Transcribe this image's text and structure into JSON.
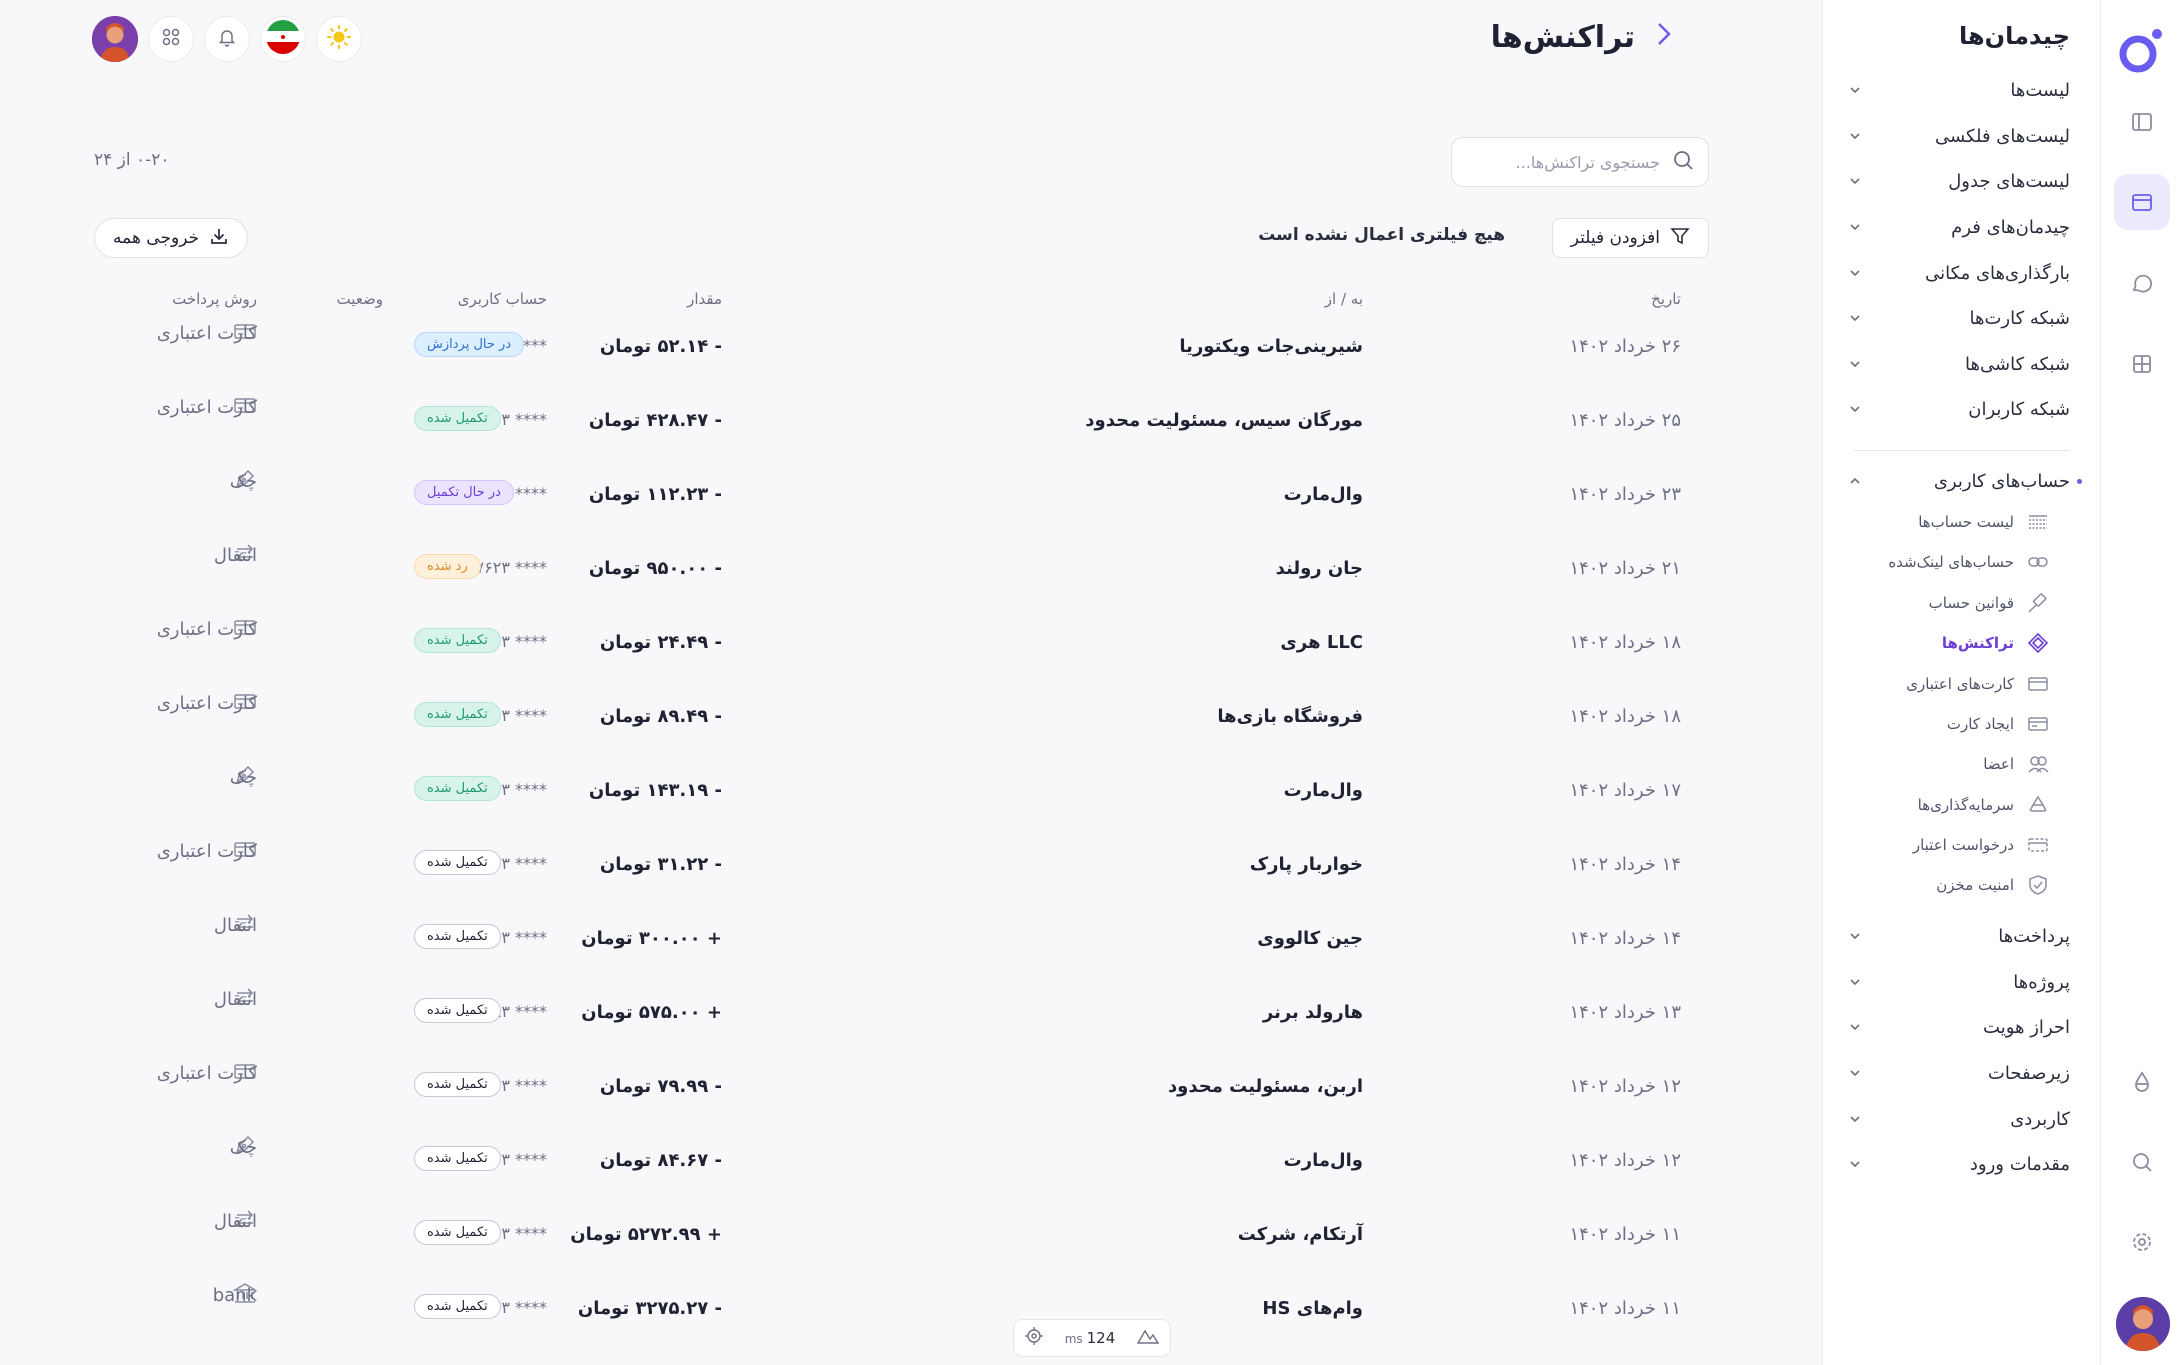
{
  "sidebar": {
    "title": "چیدمان‌ها",
    "items": [
      {
        "label": "لیست‌ها"
      },
      {
        "label": "لیست‌های فلکسی"
      },
      {
        "label": "لیست‌های جدول"
      },
      {
        "label": "چیدمان‌های فرم"
      },
      {
        "label": "بارگذاری‌های مکانی"
      },
      {
        "label": "شبکه کارت‌ها"
      },
      {
        "label": "شبکه کاشی‌ها"
      },
      {
        "label": "شبکه کاربران"
      }
    ],
    "section_label": "حساب‌های کاربری",
    "subitems": [
      {
        "label": "لیست حساب‌ها",
        "icon": "list-icon"
      },
      {
        "label": "حساب‌های لینک‌شده",
        "icon": "link-icon"
      },
      {
        "label": "قوانین حساب",
        "icon": "gavel-icon"
      },
      {
        "label": "تراکنش‌ها",
        "icon": "transactions-icon",
        "active": true
      },
      {
        "label": "کارت‌های اعتباری",
        "icon": "credit-card-icon"
      },
      {
        "label": "ایجاد کارت",
        "icon": "card-add-icon"
      },
      {
        "label": "اعضا",
        "icon": "members-icon"
      },
      {
        "label": "سرمایه‌گذاری‌ها",
        "icon": "recycle-icon"
      },
      {
        "label": "درخواست اعتبار",
        "icon": "credit-request-icon"
      },
      {
        "label": "امنیت مخزن",
        "icon": "shield-icon"
      }
    ],
    "bottom_items": [
      {
        "label": "پرداخت‌ها"
      },
      {
        "label": "پروژه‌ها"
      },
      {
        "label": "احراز هویت"
      },
      {
        "label": "زیرصفحات"
      },
      {
        "label": "کاربردی"
      },
      {
        "label": "مقدمات ورود"
      }
    ]
  },
  "page": {
    "title": "تراکنش‌ها",
    "count": "۰-۲۰ از ۲۴",
    "search_placeholder": "جستجوی تراکنش‌ها...",
    "filter_button": "افزودن فیلتر",
    "filter_status": "هیچ فیلتری اعمال نشده است",
    "export_button": "خروجی همه"
  },
  "table": {
    "headers": {
      "date": "تاریخ",
      "party": "به / از",
      "amount": "مقدار",
      "account": "حساب کاربری",
      "status": "وضعیت",
      "method": "روش پرداخت"
    },
    "rows": [
      {
        "date": "۲۶ خرداد ۱۴۰۲",
        "party": "شیرینی‌جات ویکتوریا",
        "amount": "- ۵۲.۱۴ تومان",
        "account": "**** ۷۶۲۳",
        "status": "در حال پردازش",
        "status_type": "processing",
        "method": "کارت اعتباری",
        "method_icon": "credit-card-icon"
      },
      {
        "date": "۲۵ خرداد ۱۴۰۲",
        "party": "مورگان سیس، مسئولیت محدود",
        "amount": "- ۴۲۸.۴۷ تومان",
        "account": "**** ۷۶۲۳",
        "status": "تکمیل شده",
        "status_type": "done-green",
        "method": "کارت اعتباری",
        "method_icon": "credit-card-icon"
      },
      {
        "date": "۲۳ خرداد ۱۴۰۲",
        "party": "وال‌مارت",
        "amount": "- ۱۱۲.۲۳ تومان",
        "account": "**** ۷۶۲۳",
        "status": "در حال تکمیل",
        "status_type": "pending",
        "method": "چک",
        "method_icon": "pen-icon"
      },
      {
        "date": "۲۱ خرداد ۱۴۰۲",
        "party": "جان رولند",
        "amount": "- ۹۵۰.۰۰ تومان",
        "account": "**** ۷۶۲۳",
        "status": "رد شده",
        "status_type": "rejected",
        "method": "انتقال",
        "method_icon": "transfer-icon"
      },
      {
        "date": "۱۸ خرداد ۱۴۰۲",
        "party": "LLC هری",
        "amount": "- ۲۴.۴۹ تومان",
        "account": "**** ۷۶۲۳",
        "status": "تکمیل شده",
        "status_type": "done-green",
        "method": "کارت اعتباری",
        "method_icon": "credit-card-icon"
      },
      {
        "date": "۱۸ خرداد ۱۴۰۲",
        "party": "فروشگاه بازی‌ها",
        "amount": "- ۸۹.۴۹ تومان",
        "account": "**** ۷۶۲۳",
        "status": "تکمیل شده",
        "status_type": "done-green",
        "method": "کارت اعتباری",
        "method_icon": "credit-card-icon"
      },
      {
        "date": "۱۷ خرداد ۱۴۰۲",
        "party": "وال‌مارت",
        "amount": "- ۱۴۳.۱۹ تومان",
        "account": "**** ۷۶۲۳",
        "status": "تکمیل شده",
        "status_type": "done-green",
        "method": "چک",
        "method_icon": "pen-icon"
      },
      {
        "date": "۱۴ خرداد ۱۴۰۲",
        "party": "خواربار پارک",
        "amount": "- ۳۱.۲۲ تومان",
        "account": "**** ۷۶۲۳",
        "status": "تکمیل شده",
        "status_type": "done-outline",
        "method": "کارت اعتباری",
        "method_icon": "credit-card-icon"
      },
      {
        "date": "۱۴ خرداد ۱۴۰۲",
        "party": "جین کالووی",
        "amount": "+ ۳۰۰.۰۰ تومان",
        "account": "**** ۷۶۲۳",
        "status": "تکمیل شده",
        "status_type": "done-outline",
        "method": "انتقال",
        "method_icon": "transfer-icon"
      },
      {
        "date": "۱۳ خرداد ۱۴۰۲",
        "party": "هارولد برنر",
        "amount": "+ ۵۷۵.۰۰ تومان",
        "account": "**** ۳۲۸۳",
        "status": "تکمیل شده",
        "status_type": "done-outline",
        "method": "انتقال",
        "method_icon": "transfer-icon"
      },
      {
        "date": "۱۲ خرداد ۱۴۰۲",
        "party": "اربن، مسئولیت محدود",
        "amount": "- ۷۹.۹۹ تومان",
        "account": "**** ۷۶۲۳",
        "status": "تکمیل شده",
        "status_type": "done-outline",
        "method": "کارت اعتباری",
        "method_icon": "credit-card-icon"
      },
      {
        "date": "۱۲ خرداد ۱۴۰۲",
        "party": "وال‌مارت",
        "amount": "- ۸۴.۶۷ تومان",
        "account": "**** ۷۶۲۳",
        "status": "تکمیل شده",
        "status_type": "done-outline",
        "method": "چک",
        "method_icon": "pen-icon"
      },
      {
        "date": "۱۱ خرداد ۱۴۰۲",
        "party": "آرتکام، شرکت",
        "amount": "+ ۵۲۷۲.۹۹ تومان",
        "account": "**** ۷۶۲۳",
        "status": "تکمیل شده",
        "status_type": "done-outline",
        "method": "انتقال",
        "method_icon": "transfer-icon"
      },
      {
        "date": "۱۱ خرداد ۱۴۰۲",
        "party": "وام‌های HS",
        "amount": "- ۳۲۷۵.۲۷ تومان",
        "account": "**** ۷۶۲۳",
        "status": "تکمیل شده",
        "status_type": "done-outline",
        "method": "bank",
        "method_icon": "bank-icon"
      }
    ]
  },
  "perf": {
    "value": "124",
    "unit": "ms"
  },
  "colors": {
    "accent": "#6b5cf0",
    "active_bg": "#ecebfd"
  }
}
